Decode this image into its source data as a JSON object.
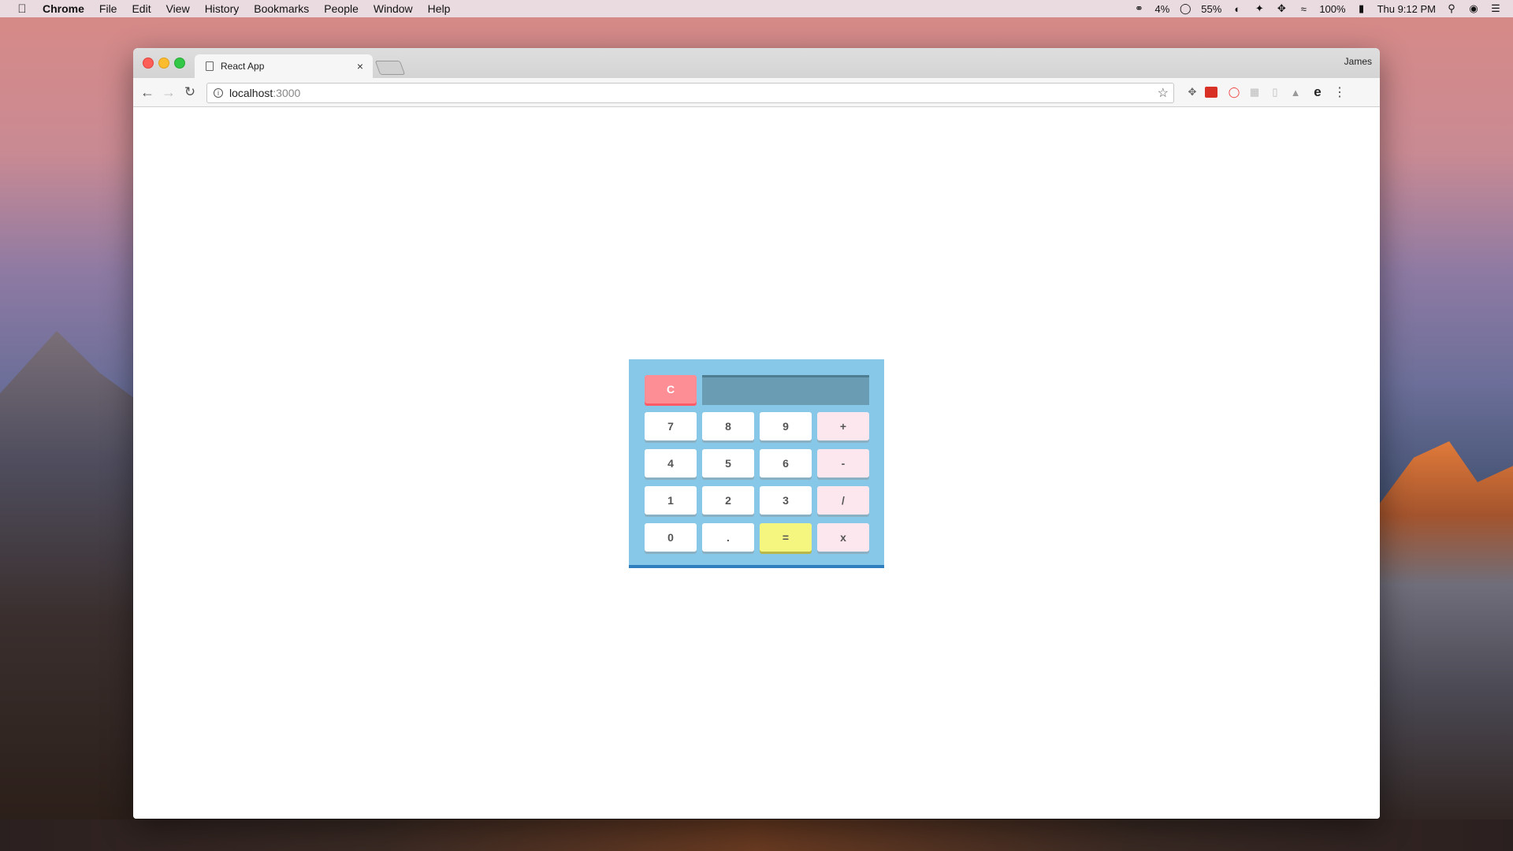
{
  "menubar": {
    "app": "Chrome",
    "items": [
      "File",
      "Edit",
      "View",
      "History",
      "Bookmarks",
      "People",
      "Window",
      "Help"
    ],
    "status": {
      "cpu": "4%",
      "memory": "55%",
      "battery": "100%",
      "clock": "Thu 9:12 PM"
    }
  },
  "browser": {
    "tab_title": "React App",
    "tab_close": "×",
    "profile_name": "James",
    "url_host": "localhost",
    "url_port": ":3000"
  },
  "calculator": {
    "display_value": "",
    "clear_label": "C",
    "keys": {
      "k7": "7",
      "k8": "8",
      "k9": "9",
      "plus": "+",
      "k4": "4",
      "k5": "5",
      "k6": "6",
      "minus": "-",
      "k1": "1",
      "k2": "2",
      "k3": "3",
      "divide": "/",
      "k0": "0",
      "dot": ".",
      "equals": "=",
      "multiply": "x"
    }
  },
  "colors": {
    "calc_bg": "#87c8e8",
    "clear_key": "#fe8e96",
    "equals_key": "#f5f67f",
    "operator_key": "#fde7ee",
    "display": "#6a9db3"
  }
}
